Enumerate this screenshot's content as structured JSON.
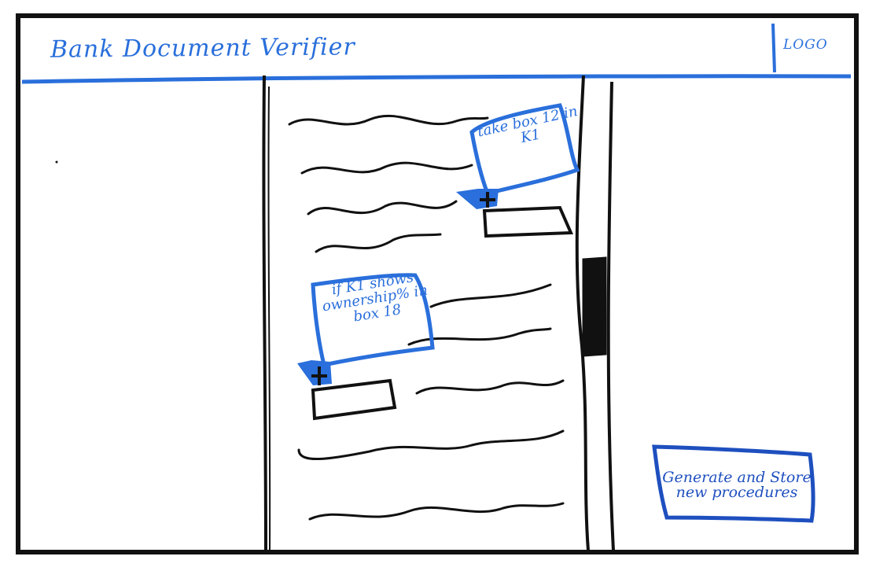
{
  "header": {
    "title": "Bank Document Verifier",
    "logo_label": "LOGO"
  },
  "document": {
    "annotations": [
      {
        "text": "take box 12 in K1"
      },
      {
        "text": "if K1 shows ownership% in box 18"
      }
    ],
    "add_icon": "plus-icon"
  },
  "actions": {
    "generate_label": "Generate and Store new procedures"
  },
  "colors": {
    "ink": "#111111",
    "blue": "#2a6fdb",
    "dark_blue": "#1e4fbf"
  }
}
